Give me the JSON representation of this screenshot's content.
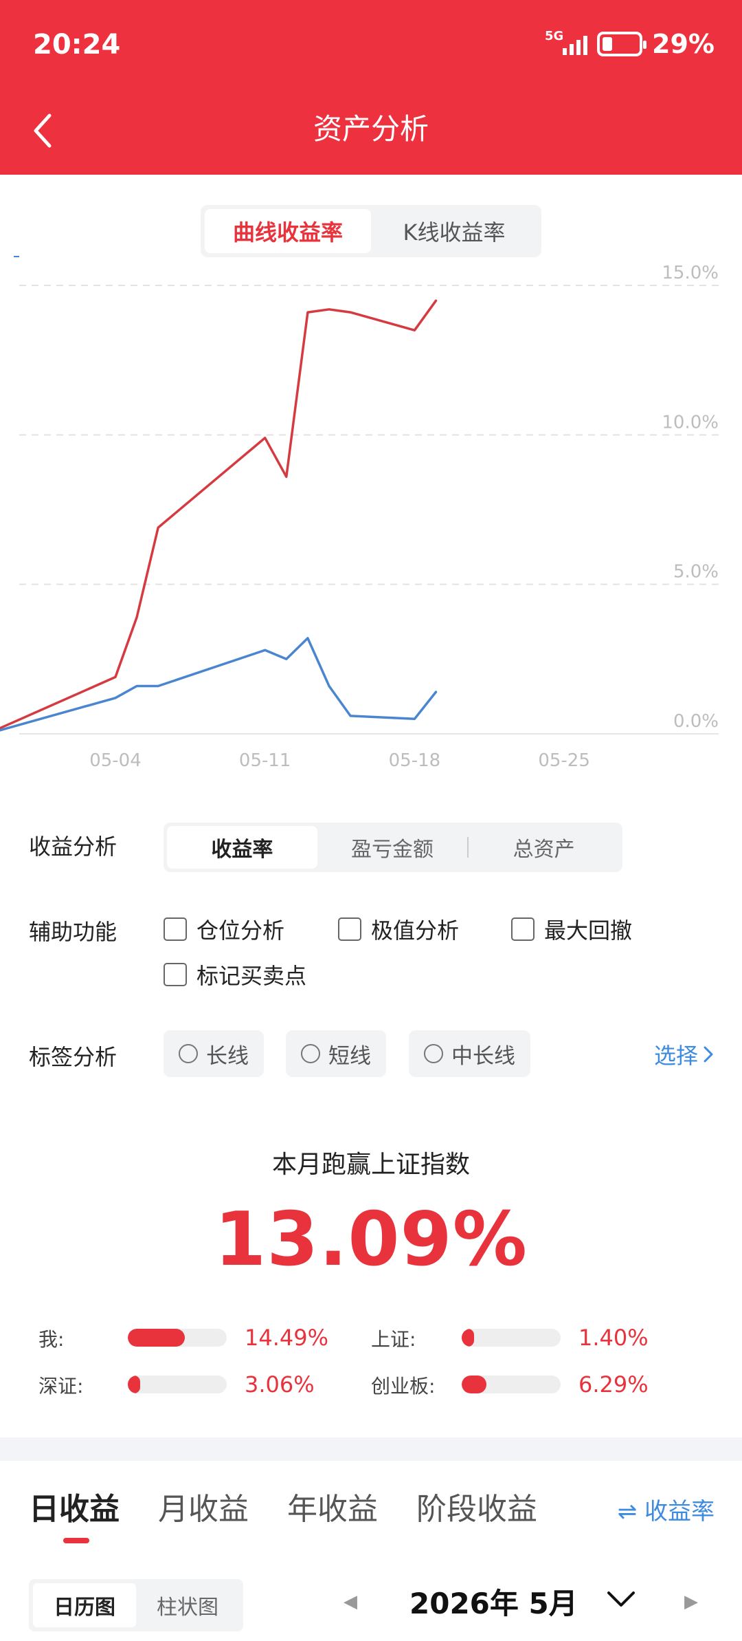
{
  "status_bar": {
    "time": "20:24",
    "network": "5G",
    "battery": "29%"
  },
  "header": {
    "title": "资产分析"
  },
  "chart_tabs": [
    {
      "label": "曲线收益率",
      "active": true
    },
    {
      "label": "K线收益率",
      "active": false
    }
  ],
  "colors": {
    "brand": "#EE313E",
    "accent_red": "#E8323C",
    "series_blue": "#4A86D0",
    "link_blue": "#3D8BE0"
  },
  "chart_data": {
    "type": "line",
    "ylim": [
      0,
      15
    ],
    "y_ticks": [
      "15.0%",
      "10.0%",
      "5.0%",
      "0.0%"
    ],
    "x_ticks": [
      "05-04",
      "05-11",
      "05-18",
      "05-25"
    ],
    "grid": true,
    "series": [
      {
        "color": "#D63A41",
        "points": [
          [
            "04-28",
            0.0
          ],
          [
            "05-04",
            1.9
          ],
          [
            "05-05",
            3.9
          ],
          [
            "05-06",
            6.9
          ],
          [
            "05-11",
            9.9
          ],
          [
            "05-12",
            8.6
          ],
          [
            "05-13",
            14.1
          ],
          [
            "05-14",
            14.2
          ],
          [
            "05-15",
            14.1
          ],
          [
            "05-18",
            13.5
          ],
          [
            "05-19",
            14.49
          ]
        ]
      },
      {
        "color": "#4A86D0",
        "points": [
          [
            "04-28",
            0.0
          ],
          [
            "05-04",
            1.2
          ],
          [
            "05-05",
            1.6
          ],
          [
            "05-06",
            1.6
          ],
          [
            "05-11",
            2.8
          ],
          [
            "05-12",
            2.5
          ],
          [
            "05-13",
            3.2
          ],
          [
            "05-14",
            1.6
          ],
          [
            "05-15",
            0.6
          ],
          [
            "05-18",
            0.5
          ],
          [
            "05-19",
            1.4
          ]
        ]
      }
    ]
  },
  "analysis": {
    "income_label": "收益分析",
    "income_tabs": [
      {
        "label": "收益率",
        "active": true
      },
      {
        "label": "盈亏金额",
        "active": false
      },
      {
        "label": "总资产",
        "active": false
      }
    ],
    "aux_label": "辅助功能",
    "aux_options": [
      "仓位分析",
      "极值分析",
      "最大回撤",
      "标记买卖点"
    ],
    "tag_label": "标签分析",
    "tag_options": [
      "长线",
      "短线",
      "中长线"
    ],
    "select_label": "选择"
  },
  "beat": {
    "title": "本月跑赢上证指数",
    "value": "13.09%",
    "items": [
      {
        "label": "我:",
        "value": "14.49%",
        "pct": 14.49
      },
      {
        "label": "上证:",
        "value": "1.40%",
        "pct": 1.4
      },
      {
        "label": "深证:",
        "value": "3.06%",
        "pct": 3.06
      },
      {
        "label": "创业板:",
        "value": "6.29%",
        "pct": 6.29
      }
    ]
  },
  "earnings_tabs": [
    {
      "label": "日收益",
      "active": true
    },
    {
      "label": "月收益",
      "active": false
    },
    {
      "label": "年收益",
      "active": false
    },
    {
      "label": "阶段收益",
      "active": false
    }
  ],
  "switch_label": "⇌ 收益率",
  "view_tabs": [
    {
      "label": "日历图",
      "active": true
    },
    {
      "label": "柱状图",
      "active": false
    }
  ],
  "month_label": "2026年 5月"
}
